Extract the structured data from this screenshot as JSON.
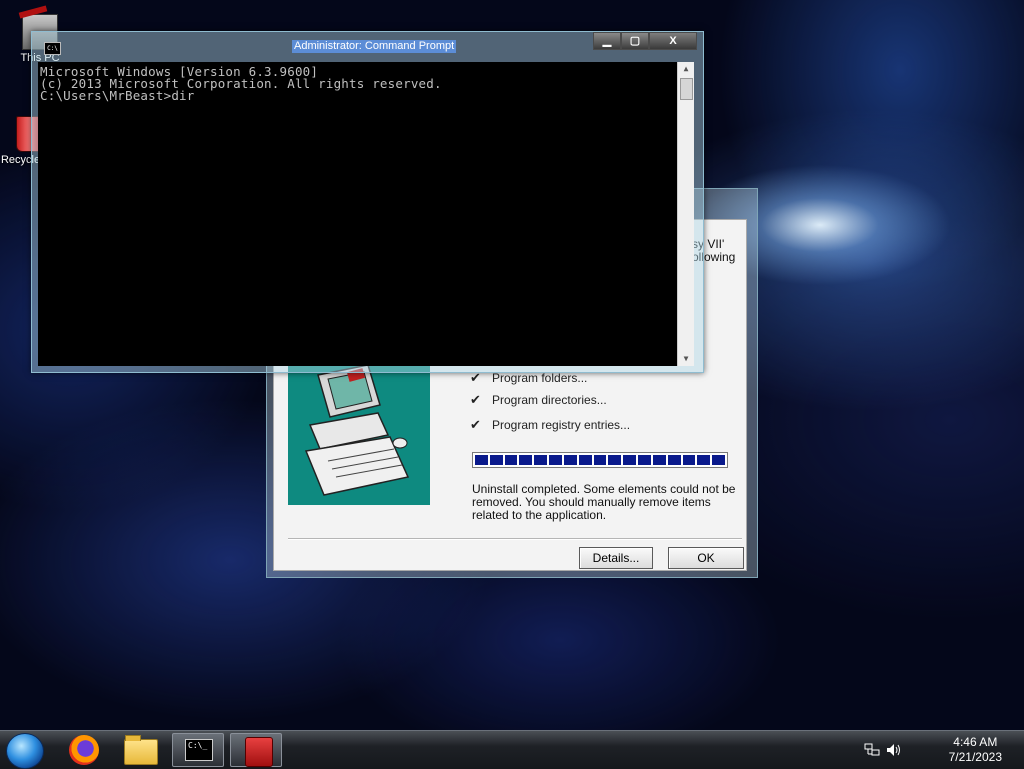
{
  "desktop": {
    "icons": [
      {
        "label": "This PC",
        "icon": "computer-icon"
      },
      {
        "label": "Recycle Bin",
        "icon": "recycle-bin-icon"
      }
    ]
  },
  "cmd_window": {
    "title": "Administrator: Command Prompt",
    "sys_icon_text": "C:\\",
    "lines": [
      "Microsoft Windows [Version 6.3.9600]",
      "(c) 2013 Microsoft Corporation. All rights reserved.",
      "",
      "C:\\Users\\MrBeast>dir"
    ],
    "minimize_label": "▁",
    "maximize_label": "▢",
    "close_label": "X"
  },
  "setup_dialog": {
    "partial_text_1": "sy VII'",
    "partial_text_2": "ollowing",
    "checklist": [
      {
        "mark": "✔",
        "label": "Program folders..."
      },
      {
        "mark": "✔",
        "label": "Program directories..."
      },
      {
        "mark": "✔",
        "label": "Program registry entries..."
      }
    ],
    "progress": {
      "fraction": 1.0,
      "blocks": 17,
      "color": "#0a1a8c"
    },
    "message": "Uninstall completed.  Some elements could not be removed.  You should manually remove items related to the application.",
    "details_label": "Details...",
    "ok_label": "OK"
  },
  "taskbar": {
    "items": [
      {
        "name": "start-button",
        "icon": "windows-orb-icon"
      },
      {
        "name": "firefox",
        "icon": "firefox-icon"
      },
      {
        "name": "file-explorer",
        "icon": "folder-icon"
      },
      {
        "name": "command-prompt",
        "icon": "cmd-icon",
        "active": true,
        "text": "C:\\_"
      },
      {
        "name": "uninstaller",
        "icon": "setup-icon",
        "active": true
      }
    ],
    "tray": {
      "network_icon": "network-icon",
      "volume_icon": "volume-icon",
      "time": "4:46 AM",
      "date": "7/21/2023"
    }
  }
}
